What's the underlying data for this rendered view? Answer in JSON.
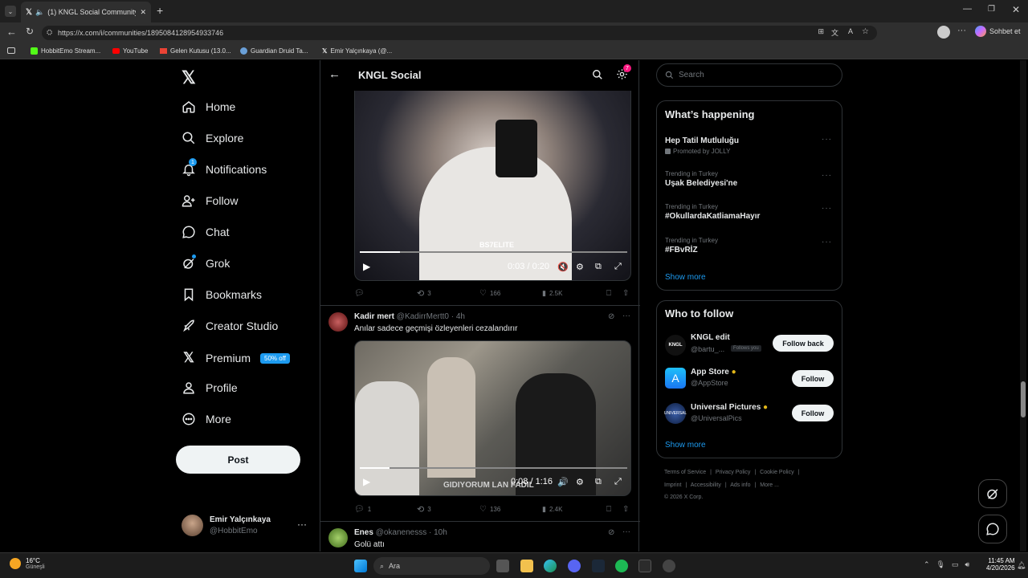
{
  "browser": {
    "tab_title": "(1) KNGL Social Community /",
    "url": "https://x.com/i/communities/1895084128954933746",
    "copilot_label": "Sohbet et",
    "bookmarks": [
      "HobbitEmo Stream...",
      "YouTube",
      "Gelen Kutusu (13.0...",
      "Guardian Druid Ta...",
      "Emir Yalçınkaya (@..."
    ]
  },
  "nav": {
    "items": [
      "Home",
      "Explore",
      "Notifications",
      "Follow",
      "Chat",
      "Grok",
      "Bookmarks",
      "Creator Studio",
      "Premium",
      "Profile",
      "More"
    ],
    "premium_badge": "50% off",
    "notification_count": "1",
    "post_label": "Post"
  },
  "account": {
    "name": "Emir Yalçınkaya",
    "handle": "@HobbitEmo"
  },
  "header": {
    "title": "KNGL Social",
    "settings_badge": "7"
  },
  "posts": [
    {
      "video_time": "0:03 / 0:20",
      "video_progress": 0.15,
      "video_overlay": "BS7ELITE",
      "replies": "",
      "reposts": "3",
      "likes": "166",
      "views": "2.5K"
    },
    {
      "author": "Kadir mert",
      "handle": "@KadirrMertt0",
      "time": "· 4h",
      "text": "Anılar sadece geçmişi özleyenleri cezalandırır",
      "video_time": "0:08 / 1:16",
      "video_progress": 0.11,
      "video_caption": "GIDIYORUM LAN FADIL",
      "replies": "1",
      "reposts": "3",
      "likes": "136",
      "views": "2.4K"
    },
    {
      "author": "Enes",
      "handle": "@okanenesss",
      "time": "· 10h",
      "text": "Golü attı"
    }
  ],
  "sidebar": {
    "search_placeholder": "Search",
    "happening_title": "What’s happening",
    "trends": [
      {
        "context": "",
        "name": "Hep Tatil Mutluluğu",
        "promo": "Promoted by JOLLY"
      },
      {
        "context": "Trending in Turkey",
        "name": "Uşak Belediyesi'ne"
      },
      {
        "context": "Trending in Turkey",
        "name": "#OkullardaKatliamaHayır"
      },
      {
        "context": "Trending in Turkey",
        "name": "#FBvRİZ"
      }
    ],
    "show_more": "Show more",
    "who_title": "Who to follow",
    "who": [
      {
        "name": "KNGL edit",
        "handle": "@bartu_...",
        "badge": "Follows you",
        "button": "Follow back"
      },
      {
        "name": "App Store",
        "handle": "@AppStore",
        "button": "Follow"
      },
      {
        "name": "Universal Pictures",
        "handle": "@UniversalPics",
        "button": "Follow"
      }
    ],
    "footer": [
      "Terms of Service",
      "Privacy Policy",
      "Cookie Policy",
      "Imprint",
      "Accessibility",
      "Ads info",
      "More ...",
      "© 2026 X Corp."
    ]
  },
  "taskbar": {
    "temp": "16°C",
    "weather": "Güneşli",
    "search": "Ara",
    "time": "11:45 AM",
    "date": "4/20/2026"
  },
  "colors": {
    "accent": "#1d9bf0",
    "verified": "#e2b719",
    "bg": "#000000",
    "border": "#2f3336"
  }
}
